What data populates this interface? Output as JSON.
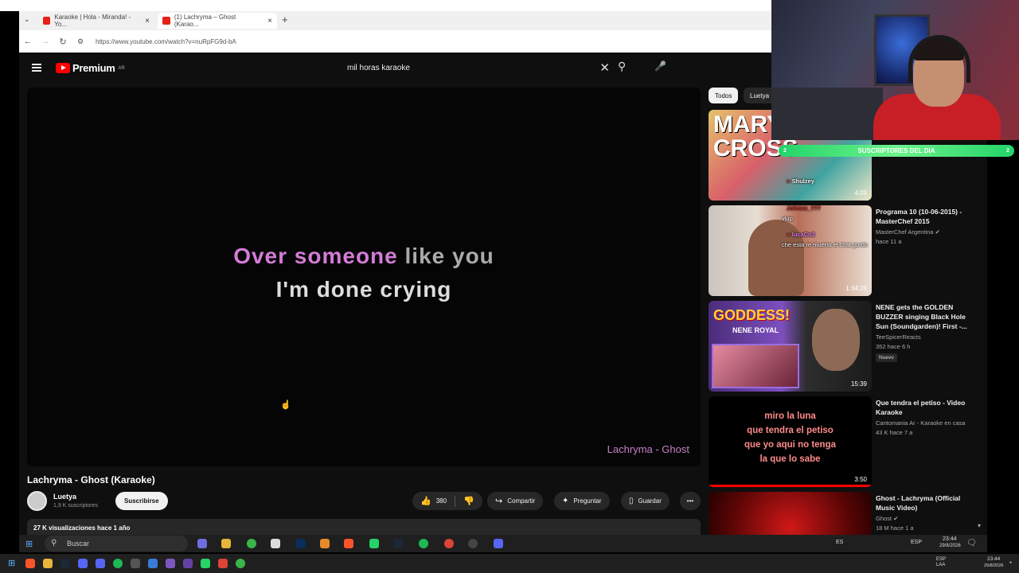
{
  "browser": {
    "tabs": [
      {
        "label": "Karaoke | Hola - Miranda! - Yo..."
      },
      {
        "label": "(1) Lachryma – Ghost (Karao..."
      }
    ],
    "url": "https://www.youtube.com/watch?v=nuRpFG9d-bA"
  },
  "masthead": {
    "logo_text": "Premium",
    "region": "AR",
    "search_value": "mil horas karaoke"
  },
  "player": {
    "lyric_line1_highlight": "Over someone ",
    "lyric_line1_rest": "like you",
    "lyric_line2": "I'm done crying",
    "watermark": "Lachryma - Ghost"
  },
  "video": {
    "title": "Lachryma - Ghost (Karaoke)",
    "channel": "Luetya",
    "subscribers": "1,9 K suscriptores",
    "subscribe_label": "Suscribirse",
    "likes": "380",
    "share_label": "Compartir",
    "ask_label": "Preguntar",
    "save_label": "Guardar",
    "views_line": "27 K visualizaciones  hace 1 año"
  },
  "chips": [
    "Todos",
    "Luetya"
  ],
  "recommendations": [
    {
      "thumb_text": "MARY ON A CROSS",
      "duration": "4:09",
      "title": "",
      "channel": "",
      "meta": ""
    },
    {
      "duration": "1:34:26",
      "title": "Programa 10 (10-06-2015) - MasterChef 2015",
      "channel": "MasterChef Argentina",
      "meta": "hace 11 a"
    },
    {
      "thumb_text": "GODDESS!",
      "thumb_sub": "NENE ROYAL",
      "duration": "15:39",
      "title": "NENE gets the GOLDEN BUZZER singing Black Hole Sun (Soundgarden)! First -...",
      "channel": "TeeSpicerReacts",
      "meta": "352  hace 6 h",
      "badge": "Nuevo"
    },
    {
      "thumb_lines": [
        "miro la luna",
        "que tendra el petiso",
        "que yo aqui no tenga",
        "la que lo sabe"
      ],
      "duration": "3:50",
      "title": "Que tendra el petiso - Video Karaoke",
      "channel": "Cantomania Ar - Karaoke en casa",
      "meta": "43 K  hace 7 a"
    },
    {
      "duration": "",
      "title": "Ghost - Lachryma (Official Music Video)",
      "channel": "Ghost",
      "meta": "18 M  hace 1 a"
    }
  ],
  "overlay": {
    "sub_bar_label": "SUSCRIPTORES DEL DIA",
    "sub_count_left": "2",
    "sub_count_right": "2"
  },
  "chat": [
    {
      "user": "Shulzey",
      "message": ""
    },
    {
      "user": "Johnxx_777",
      "message": "viup"
    },
    {
      "user": "lucaCo2",
      "message": "che esta re muerto el chat gordo"
    }
  ],
  "taskbar": {
    "search_placeholder": "Buscar",
    "lang": "ESP",
    "time": "23:44",
    "date": "29/8/2026",
    "outer_lang": "ESP\nLAA",
    "outer_time": "23:44",
    "outer_date": "29/8/2026"
  },
  "colors": {
    "youtube_red": "#ff0000",
    "lyric_highlight": "#d47bd8",
    "sub_bar": "#23d46a"
  }
}
